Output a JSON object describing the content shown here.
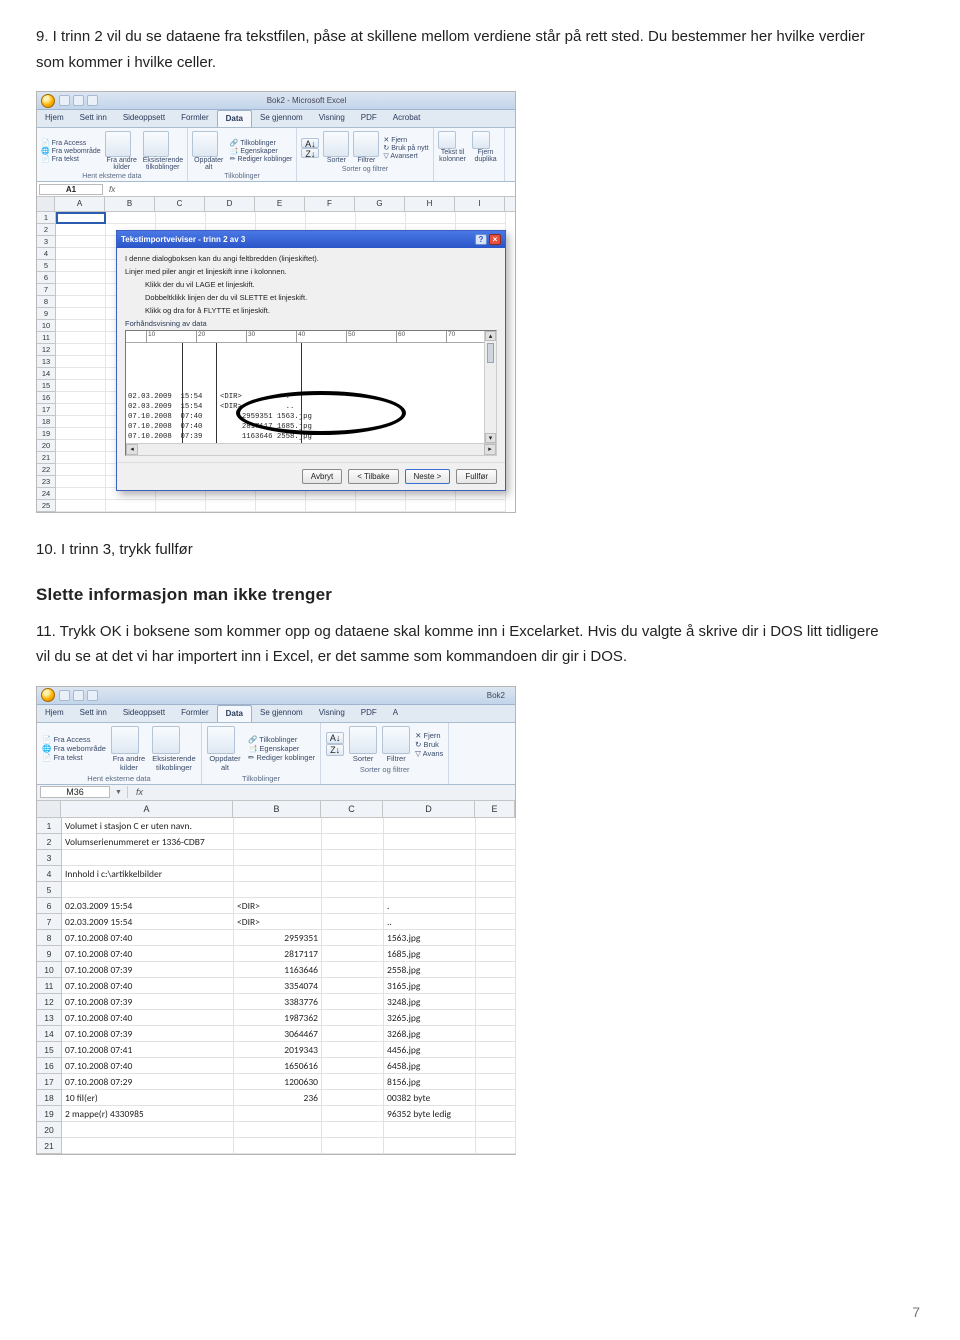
{
  "intro1": "9. I trinn 2 vil du se dataene fra tekstfilen, påse at skillene mellom verdiene står på rett sted. Du bestemmer her hvilke verdier som kommer i hvilke celler.",
  "intro2": "10. I trinn 3, trykk fullfør",
  "section_heading": "Slette informasjon man ikke trenger",
  "intro3": "11. Trykk OK i boksene som kommer opp og dataene skal komme inn i Excelarket. Hvis du valgte å skrive dir i DOS litt tidligere vil du se at det vi har importert inn i Excel, er det samme som kommandoen dir gir i DOS.",
  "page_number": "7",
  "fig1": {
    "title": "Bok2 - Microsoft Excel",
    "tabs": [
      "Hjem",
      "Sett inn",
      "Sideoppsett",
      "Formler",
      "Data",
      "Se gjennom",
      "Visning",
      "PDF",
      "Acrobat"
    ],
    "active_tab": "Data",
    "ribbon": {
      "group1": {
        "items": [
          "Fra Access",
          "Fra webområde",
          "Fra tekst"
        ],
        "big_items": [
          "Fra andre kilder",
          "Eksisterende tilkoblinger"
        ],
        "caption": "Hent eksterne data"
      },
      "group2": {
        "big": "Oppdater alt",
        "items": [
          "Tilkoblinger",
          "Egenskaper",
          "Rediger koblinger"
        ],
        "caption": "Tilkoblinger"
      },
      "group3": {
        "sort": "Sorter",
        "filter": "Filtrer",
        "items": [
          "Fjern",
          "Bruk på nytt",
          "Avansert"
        ],
        "caption": "Sorter og filtrer"
      },
      "group4": {
        "items": [
          "Tekst til kolonner",
          "Fjern duplika"
        ]
      }
    },
    "namebox": "A1",
    "cols": [
      "A",
      "B",
      "C",
      "D",
      "E",
      "F",
      "G",
      "H",
      "I"
    ],
    "rows": 25,
    "wizard": {
      "title": "Tekstimportveiviser - trinn 2 av 3",
      "desc1": "I denne dialogboksen kan du angi feltbredden (linjeskiftet).",
      "desc2": "Linjer med piler angir et linjeskift inne i kolonnen.",
      "hint1": "Klikk der du vil LAGE et linjeskift.",
      "hint2": "Dobbeltklikk linjen der du vil SLETTE et linjeskift.",
      "hint3": "Klikk og dra for å FLYTTE et linjeskift.",
      "preview_label": "Forhåndsvisning av data",
      "ruler_marks": [
        "10",
        "20",
        "30",
        "40",
        "50",
        "60",
        "70"
      ],
      "lines": [
        "02.03.2009  15:54    <DIR>          .",
        "02.03.2009  15:54    <DIR>          ..",
        "07.10.2008  07:40         2959351 1563.jpg",
        "07.10.2008  07:40         2817117 1685.jpg",
        "07.10.2008  07:39         1163646 2558.jpg"
      ],
      "buttons": {
        "cancel": "Avbryt",
        "back": "< Tilbake",
        "next": "Neste >",
        "finish": "Fullfør"
      }
    }
  },
  "fig2": {
    "title": "Bok2",
    "tabs": [
      "Hjem",
      "Sett inn",
      "Sideoppsett",
      "Formler",
      "Data",
      "Se gjennom",
      "Visning",
      "PDF",
      "A"
    ],
    "active_tab": "Data",
    "ribbon": {
      "group1": {
        "items": [
          "Fra Access",
          "Fra webområde",
          "Fra tekst"
        ],
        "big_items": [
          "Fra andre kilder",
          "Eksisterende tilkoblinger"
        ],
        "caption": "Hent eksterne data"
      },
      "group2": {
        "big": "Oppdater alt",
        "items": [
          "Tilkoblinger",
          "Egenskaper",
          "Rediger koblinger"
        ],
        "caption": "Tilkoblinger"
      },
      "group3": {
        "sort": "Sorter",
        "filter": "Filtrer",
        "items": [
          "Fjern",
          "Bruk",
          "Avans"
        ],
        "caption": "Sorter og filtrer"
      }
    },
    "namebox": "M36",
    "cols": [
      "A",
      "B",
      "C",
      "D",
      "E"
    ],
    "data": [
      [
        "Volumet i stasjon C er uten navn.",
        "",
        "",
        "",
        ""
      ],
      [
        "Volumserienummeret er 1336-CDB7",
        "",
        "",
        "",
        ""
      ],
      [
        "",
        "",
        "",
        "",
        ""
      ],
      [
        "Innhold i c:\\artikkelbilder",
        "",
        "",
        "",
        ""
      ],
      [
        "",
        "",
        "",
        "",
        ""
      ],
      [
        "02.03.2009 15:54",
        "<DIR>",
        "",
        ".",
        ""
      ],
      [
        "02.03.2009 15:54",
        "<DIR>",
        "",
        "..",
        ""
      ],
      [
        "07.10.2008 07:40",
        "2959351",
        "",
        "1563.jpg",
        ""
      ],
      [
        "07.10.2008 07:40",
        "2817117",
        "",
        "1685.jpg",
        ""
      ],
      [
        "07.10.2008 07:39",
        "1163646",
        "",
        "2558.jpg",
        ""
      ],
      [
        "07.10.2008 07:40",
        "3354074",
        "",
        "3165.jpg",
        ""
      ],
      [
        "07.10.2008 07:39",
        "3383776",
        "",
        "3248.jpg",
        ""
      ],
      [
        "07.10.2008 07:40",
        "1987362",
        "",
        "3265.jpg",
        ""
      ],
      [
        "07.10.2008 07:39",
        "3064467",
        "",
        "3268.jpg",
        ""
      ],
      [
        "07.10.2008 07:41",
        "2019343",
        "",
        "4456.jpg",
        ""
      ],
      [
        "07.10.2008 07:40",
        "1650616",
        "",
        "6458.jpg",
        ""
      ],
      [
        "07.10.2008 07:29",
        "1200630",
        "",
        "8156.jpg",
        ""
      ],
      [
        "10 fil(er)",
        "236",
        "",
        "00382 byte",
        ""
      ],
      [
        "2 mappe(r)  4330985",
        "",
        "",
        "96352 byte ledig",
        ""
      ],
      [
        "",
        "",
        "",
        "",
        ""
      ],
      [
        "",
        "",
        "",
        "",
        ""
      ]
    ]
  }
}
